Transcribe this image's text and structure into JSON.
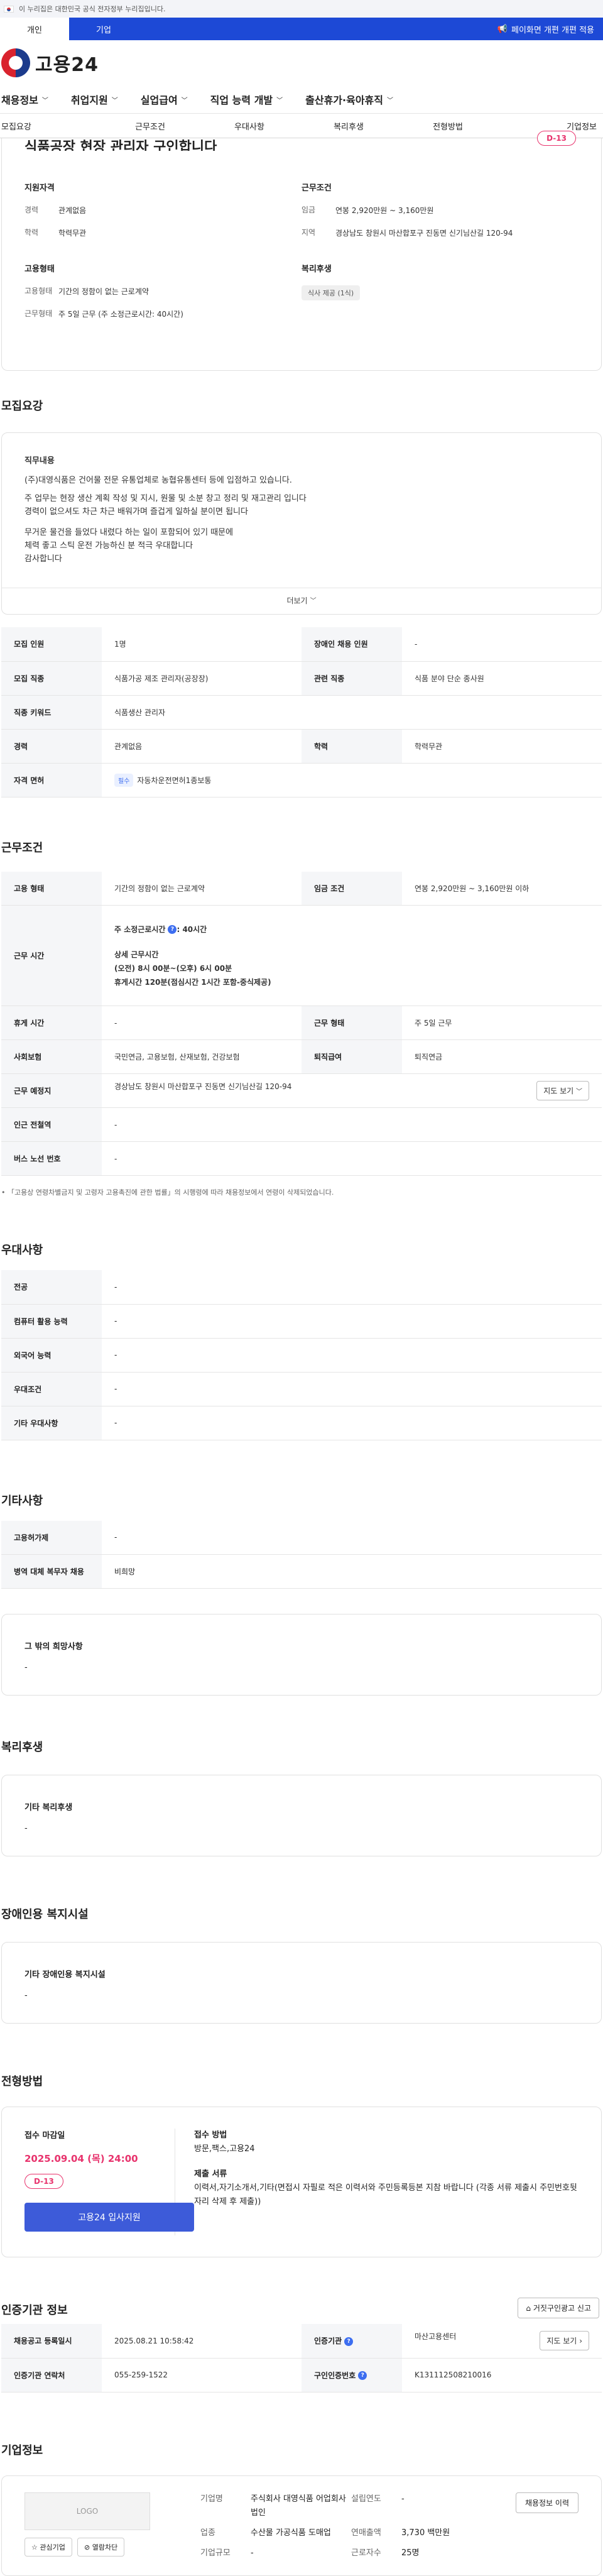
{
  "gov_banner": "이 누리집은 대한민국 공식 전자정부 누리집입니다.",
  "user_tabs": [
    "개인",
    "기업"
  ],
  "mobile_link": "페이화면 개편 개편 적용",
  "logo_text": "고용24",
  "gnb": [
    "채용정보",
    "취업지원",
    "실업급여",
    "직업 능력 개발",
    "출산휴가·육아휴직"
  ],
  "subnav": [
    "모집요강",
    "근무조건",
    "우대사항",
    "복리후생",
    "전형방법",
    "기업정보"
  ],
  "job": {
    "title": "식품공장 현장 관리자 구인합니다",
    "dday": "D-13",
    "qual_title": "지원자격",
    "career_k": "경력",
    "career_v": "관계없음",
    "edu_k": "학력",
    "edu_v": "학력무관",
    "cond_title": "근무조건",
    "wage_k": "임금",
    "wage_v": "연봉 2,920만원 ~ 3,160만원",
    "area_k": "지역",
    "area_v": "경상남도 창원시 마산합포구 진동면 신기님산길 120-94",
    "emp_title": "고용형태",
    "emptype_k": "고용형태",
    "emptype_v": "기간의 정함이 없는 근로계약",
    "worktime_k": "근무형태",
    "worktime_v": "주 5일 근무 (주 소정근로시간: 40시간)",
    "welfare_title": "복리후생",
    "welfare_pill": "식사 제공 (1식)"
  },
  "recruit": {
    "section": "모집요강",
    "duty_label": "직무내용",
    "lines": [
      "(주)대영식품은 건어물 전문 유통업체로 농협유통센터 등에 입점하고 있습니다.",
      "",
      "주 업무는 현장 생산 계획 작성 및 지시, 원물 및 소분 창고 정리 및 재고관리 입니다",
      "경력이 없으셔도 차근 차근 배워가며 즐겁게 일하실 분이면 됩니다",
      "",
      "무거운 물건을 들었다 내렸다 하는 일이 포함되어 있기 때문에",
      "체력 좋고 스틱 운전 가능하신 분 적극 우대합니다",
      "감사합니다"
    ],
    "more": "더보기",
    "rows": [
      [
        "모집 인원",
        "1명",
        "장애인 채용 인원",
        "-"
      ],
      [
        "모집 직종",
        "식품가공 제조 관리자(공장장)",
        "관련 직종",
        "식품 분야 단순 종사원"
      ],
      [
        "직종 키워드",
        "식품생산 관리자",
        "",
        ""
      ],
      [
        "경력",
        "관계없음",
        "학력",
        "학력무관"
      ]
    ],
    "license_k": "자격 면허",
    "license_badge": "필수",
    "license_v": "자동차운전면허1종보통"
  },
  "work": {
    "section": "근무조건",
    "emptype_k": "고용 형태",
    "emptype_v": "기간의 정함이 없는 근로계약",
    "wage_k": "임금 조건",
    "wage_v": "연봉 2,920만원 ~ 3,160만원 이하",
    "hours_k": "근무 시간",
    "hours_week": "주 소정근로시간",
    "hours_week_v": ": 40시간",
    "hours_detail_title": "상세 근무시간",
    "hours_detail_1": "(오전) 8시 00분~(오후) 6시 00분",
    "hours_detail_2": "휴게시간 120분(점심시간 1시간 포함-중식제공)",
    "break_k": "휴게 시간",
    "break_v": "-",
    "form_k": "근무 형태",
    "form_v": "주 5일 근무",
    "insurance_k": "사회보험",
    "insurance_v": "국민연금, 고용보험, 산재보험, 건강보험",
    "retire_k": "퇴직급여",
    "retire_v": "퇴직연금",
    "place_k": "근무 예정지",
    "place_v": "경상남도 창원시 마산합포구 진동면 신기님산길 120-94",
    "map_btn": "지도 보기",
    "subway_k": "인근 전철역",
    "subway_v": "-",
    "bus_k": "버스 노선 번호",
    "bus_v": "-",
    "note": "「고용상 연령차별금지 및 고령자 고용촉진에 관한 법률」의 시행령에 따라 채용정보에서 연령이 삭제되었습니다."
  },
  "pref": {
    "section": "우대사항",
    "rows": [
      [
        "전공",
        "-"
      ],
      [
        "컴퓨터 활용 능력",
        "-"
      ],
      [
        "외국어 능력",
        "-"
      ],
      [
        "우대조건",
        "-"
      ],
      [
        "기타 우대사항",
        "-"
      ]
    ]
  },
  "etc": {
    "section": "기타사항",
    "rows": [
      [
        "고용허가제",
        "-"
      ],
      [
        "병역 대체 복무자 채용",
        "비희망"
      ]
    ],
    "other_label": "그 밖의 희망사항",
    "other_v": "-"
  },
  "welfare": {
    "section": "복리후생",
    "label": "기타 복리후생",
    "v": "-"
  },
  "disabled": {
    "section": "장애인용 복지시설",
    "label": "기타 장애인용 복지시설",
    "v": "-"
  },
  "process": {
    "section": "전형방법",
    "deadline_label": "접수 마감일",
    "deadline": "2025.09.04 (목) 24:00",
    "dday": "D-13",
    "apply_btn": "고용24 입사지원",
    "method_label": "접수 방법",
    "method_v": "방문,팩스,고용24",
    "docs_label": "제출 서류",
    "docs_v": "이력서,자기소개서,기타(면접시 자필로 적은 이력서와 주민등록등본 지참 바랍니다 (각종 서류 제출시 주민번호뒷자리 삭제 후 제출))"
  },
  "cert": {
    "section": "인증기관 정보",
    "report_btn": "거짓구인광고 신고",
    "reg_k": "채용공고 등록일시",
    "reg_v": "2025.08.21 10:58:42",
    "agency_k": "인증기관",
    "agency_v": "마산고용센터",
    "map_btn": "지도 보기",
    "contact_k": "인증기관 연락처",
    "contact_v": "055-259-1522",
    "auth_k": "구인인증번호",
    "auth_v": "K131112508210016"
  },
  "company": {
    "section": "기업정보",
    "logo": "LOGO",
    "fav_btn": "관심기업",
    "block_btn": "열람차단",
    "name_k": "기업명",
    "name_v": "주식회사 대영식품 어업회사법인",
    "industry_k": "업종",
    "industry_v": "수산물 가공식품 도매업",
    "scale_k": "기업규모",
    "scale_v": "-",
    "founded_k": "설립연도",
    "founded_v": "-",
    "revenue_k": "연매출액",
    "revenue_v": "3,730 백만원",
    "staff_k": "근로자수",
    "staff_v": "25명",
    "hire_btn": "채용정보 이력"
  }
}
